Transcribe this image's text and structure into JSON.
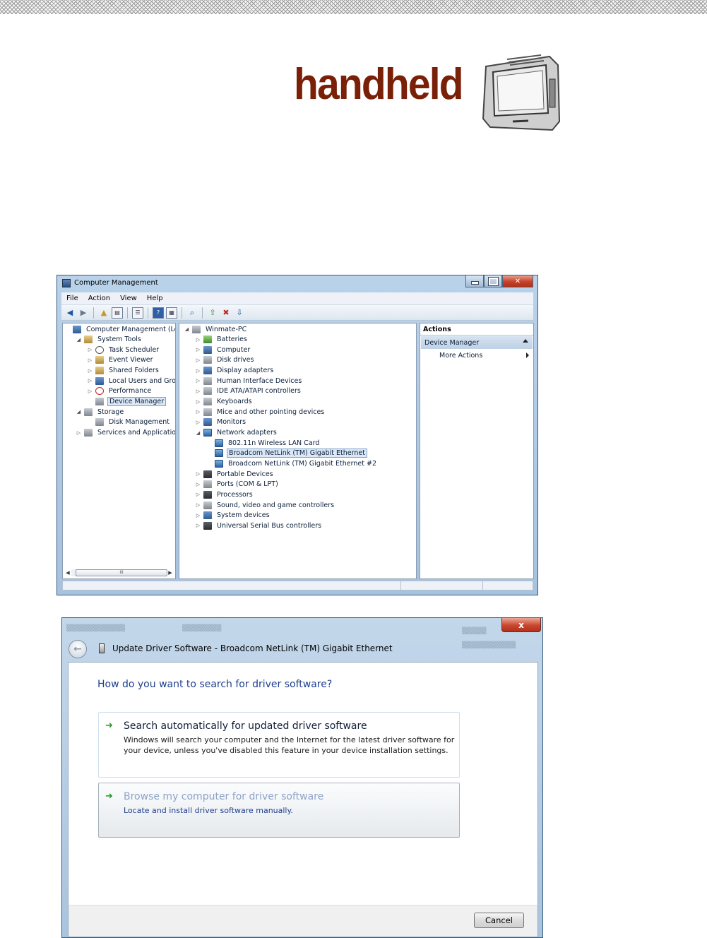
{
  "brand": {
    "name": "handheld"
  },
  "computer_management": {
    "title": "Computer Management",
    "menu": [
      "File",
      "Action",
      "View",
      "Help"
    ],
    "left_tree": [
      {
        "label": "Computer Management (Local",
        "icon": "computer-management-icon",
        "level": 0,
        "expander": ""
      },
      {
        "label": "System Tools",
        "icon": "tools-icon",
        "level": 1,
        "expander": "◢"
      },
      {
        "label": "Task Scheduler",
        "icon": "clock-icon",
        "level": 2,
        "expander": "▷"
      },
      {
        "label": "Event Viewer",
        "icon": "event-viewer-icon",
        "level": 2,
        "expander": "▷"
      },
      {
        "label": "Shared Folders",
        "icon": "shared-folder-icon",
        "level": 2,
        "expander": "▷"
      },
      {
        "label": "Local Users and Groups",
        "icon": "users-icon",
        "level": 2,
        "expander": "▷"
      },
      {
        "label": "Performance",
        "icon": "performance-icon",
        "level": 2,
        "expander": "▷"
      },
      {
        "label": "Device Manager",
        "icon": "device-manager-icon",
        "level": 2,
        "expander": "",
        "selected": true
      },
      {
        "label": "Storage",
        "icon": "storage-icon",
        "level": 1,
        "expander": "◢"
      },
      {
        "label": "Disk Management",
        "icon": "disk-management-icon",
        "level": 2,
        "expander": ""
      },
      {
        "label": "Services and Applications",
        "icon": "services-icon",
        "level": 1,
        "expander": "▷"
      }
    ],
    "device_tree": [
      {
        "label": "Winmate-PC",
        "icon": "pc-icon",
        "level": 0,
        "expander": "◢"
      },
      {
        "label": "Batteries",
        "icon": "battery-icon",
        "level": 1,
        "expander": "▷"
      },
      {
        "label": "Computer",
        "icon": "computer-icon",
        "level": 1,
        "expander": "▷"
      },
      {
        "label": "Disk drives",
        "icon": "disk-drive-icon",
        "level": 1,
        "expander": "▷"
      },
      {
        "label": "Display adapters",
        "icon": "display-adapter-icon",
        "level": 1,
        "expander": "▷"
      },
      {
        "label": "Human Interface Devices",
        "icon": "hid-icon",
        "level": 1,
        "expander": "▷"
      },
      {
        "label": "IDE ATA/ATAPI controllers",
        "icon": "ide-controller-icon",
        "level": 1,
        "expander": "▷"
      },
      {
        "label": "Keyboards",
        "icon": "keyboard-icon",
        "level": 1,
        "expander": "▷"
      },
      {
        "label": "Mice and other pointing devices",
        "icon": "mouse-icon",
        "level": 1,
        "expander": "▷"
      },
      {
        "label": "Monitors",
        "icon": "monitor-icon",
        "level": 1,
        "expander": "▷"
      },
      {
        "label": "Network adapters",
        "icon": "network-adapter-icon",
        "level": 1,
        "expander": "◢"
      },
      {
        "label": "802.11n Wireless LAN Card",
        "icon": "network-card-icon",
        "level": 2,
        "expander": ""
      },
      {
        "label": "Broadcom NetLink (TM) Gigabit Ethernet",
        "icon": "network-card-icon",
        "level": 2,
        "expander": "",
        "selected": true
      },
      {
        "label": "Broadcom NetLink (TM) Gigabit Ethernet #2",
        "icon": "network-card-icon",
        "level": 2,
        "expander": ""
      },
      {
        "label": "Portable Devices",
        "icon": "portable-device-icon",
        "level": 1,
        "expander": "▷"
      },
      {
        "label": "Ports (COM & LPT)",
        "icon": "port-icon",
        "level": 1,
        "expander": "▷"
      },
      {
        "label": "Processors",
        "icon": "processor-icon",
        "level": 1,
        "expander": "▷"
      },
      {
        "label": "Sound, video and game controllers",
        "icon": "sound-icon",
        "level": 1,
        "expander": "▷"
      },
      {
        "label": "System devices",
        "icon": "system-device-icon",
        "level": 1,
        "expander": "▷"
      },
      {
        "label": "Universal Serial Bus controllers",
        "icon": "usb-icon",
        "level": 1,
        "expander": "▷"
      }
    ],
    "actions": {
      "header": "Actions",
      "section": "Device Manager",
      "more": "More Actions"
    },
    "scroll_thumb_label": "III"
  },
  "update_driver": {
    "title": "Update Driver Software - Broadcom NetLink (TM) Gigabit Ethernet",
    "question": "How do you want to search for driver software?",
    "option_auto": {
      "title": "Search automatically for updated driver software",
      "description": "Windows will search your computer and the Internet for the latest driver software for your device, unless you've disabled this feature in your device installation settings."
    },
    "option_browse": {
      "title": "Browse my computer for driver software",
      "description": "Locate and install driver software manually."
    },
    "cancel_label": "Cancel",
    "close_label": "x"
  }
}
